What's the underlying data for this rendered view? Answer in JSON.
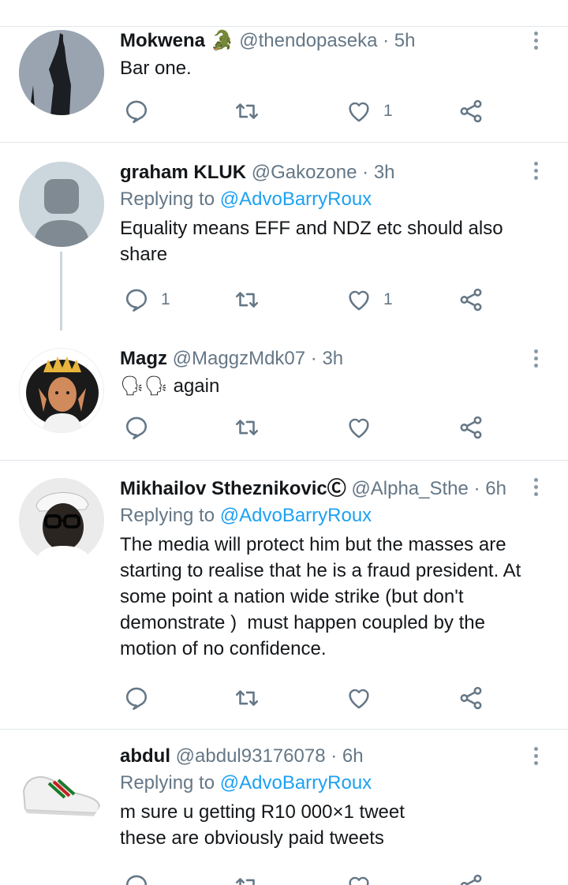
{
  "colors": {
    "accent": "#1da1f2",
    "muted": "#657786",
    "text": "#14171a",
    "divider": "#e1e8ed"
  },
  "tweets": [
    {
      "name": "Mokwena",
      "emoji": "🐊",
      "handle": "@thendopaseka",
      "dot": "·",
      "time": "5h",
      "replying_prefix": "",
      "replying_to": "",
      "lines": [
        "Bar one."
      ],
      "reply_count": "",
      "retweet_count": "",
      "like_count": "1"
    },
    {
      "name": "graham KLUK",
      "emoji": "",
      "handle": "@Gakozone",
      "dot": "·",
      "time": "3h",
      "replying_prefix": "Replying to",
      "replying_to": "@AdvoBarryRoux",
      "lines": [
        "Equality means EFF and NDZ etc should also",
        "share"
      ],
      "reply_count": "1",
      "retweet_count": "",
      "like_count": "1"
    },
    {
      "name": "Magz",
      "emoji": "",
      "handle": "@MaggzMdk07",
      "dot": "·",
      "time": "3h",
      "replying_prefix": "",
      "replying_to": "",
      "lines": [
        "🗣🗣 again"
      ],
      "reply_count": "",
      "retweet_count": "",
      "like_count": ""
    },
    {
      "name": "Mikhailov Stheznikovic",
      "emoji": "Ⓒ",
      "handle": "@Alpha_Sthe",
      "dot": "·",
      "time": "6h",
      "replying_prefix": "Replying to",
      "replying_to": "@AdvoBarryRoux",
      "lines": [
        "The media will protect him but the masses are",
        "starting to realise that he is a fraud president. At",
        "some point a nation wide strike (but don't",
        "demonstrate )  must happen coupled by the",
        "motion of no confidence."
      ],
      "reply_count": "",
      "retweet_count": "",
      "like_count": ""
    },
    {
      "name": "abdul",
      "emoji": "",
      "handle": "@abdul93176078",
      "dot": "·",
      "time": "6h",
      "replying_prefix": "Replying to",
      "replying_to": "@AdvoBarryRoux",
      "lines": [
        "m sure u getting R10 000×1 tweet",
        "these are obviously paid tweets"
      ],
      "reply_count": "",
      "retweet_count": "",
      "like_count": ""
    }
  ]
}
